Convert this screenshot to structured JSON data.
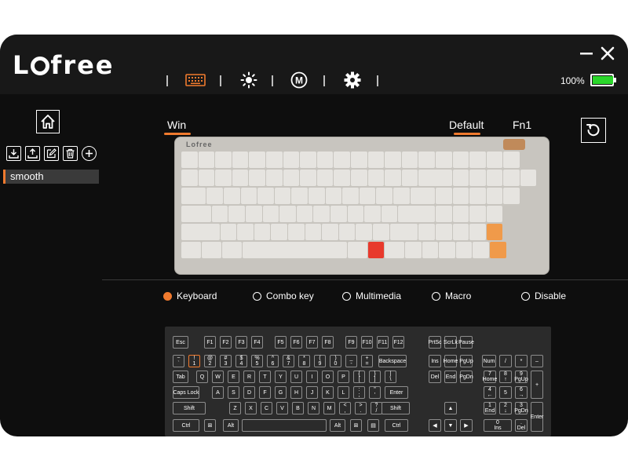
{
  "app": {
    "logo": "Lofree",
    "battery_percent": "100%",
    "battery_level": 1.0,
    "colors": {
      "accent": "#f07a2e",
      "battery": "#2bd62b",
      "background": "#0e0e0e"
    }
  },
  "nav": {
    "items": [
      {
        "icon": "keyboard-icon",
        "active": true
      },
      {
        "icon": "brightness-icon",
        "active": false
      },
      {
        "icon": "macro-m-icon",
        "active": false
      },
      {
        "icon": "gear-icon",
        "active": false
      }
    ]
  },
  "sidebar": {
    "tools": [
      "import-icon",
      "export-icon",
      "edit-icon",
      "delete-icon",
      "add-icon"
    ],
    "profiles": [
      "smooth"
    ]
  },
  "main": {
    "os_tab": "Win",
    "layer_tabs": [
      "Default",
      "Fn1"
    ],
    "keyboard_brand": "Lofree",
    "key_types": [
      "Keyboard",
      "Combo key",
      "Multimedia",
      "Macro",
      "Disable"
    ],
    "selected_key_type": "Keyboard"
  },
  "layout_keys": {
    "esc": "Esc",
    "f1": "F1",
    "f2": "F2",
    "f3": "F3",
    "f4": "F4",
    "f5": "F5",
    "f6": "F6",
    "f7": "F7",
    "f8": "F8",
    "f9": "F9",
    "f10": "F10",
    "f11": "F11",
    "f12": "F12",
    "prtsc": "PrtSc",
    "scrlk": "ScrLk",
    "pause": "Pause",
    "backtick": "~\n`",
    "n1": "!\n1",
    "n2": "@\n2",
    "n3": "#\n3",
    "n4": "$\n4",
    "n5": "%\n5",
    "n6": "^\n6",
    "n7": "&\n7",
    "n8": "*\n8",
    "n9": "(\n9",
    "n0": ")\n0",
    "minus": "_\n-",
    "equal": "+\n=",
    "backspace": "Backspace",
    "ins": "Ins",
    "home": "Home",
    "pgup": "PgUp",
    "num": "Num",
    "np_div": "/",
    "np_mul": "*",
    "np_minus": "–",
    "tab": "Tab",
    "q": "Q",
    "w": "W",
    "e": "E",
    "r": "R",
    "t": "T",
    "y": "Y",
    "u": "U",
    "i": "I",
    "o": "O",
    "p": "P",
    "lbracket": "{\n[",
    "rbracket": "}\n]",
    "backslash": "|\n\\",
    "del": "Del",
    "end": "End",
    "pgdn": "PgDn",
    "np7": "7\nHome",
    "np8": "8\n↑",
    "np9": "9\nPgUp",
    "np_plus": "+",
    "capslock": "Caps Lock",
    "a": "A",
    "s": "S",
    "d": "D",
    "f": "F",
    "g": "G",
    "h": "H",
    "j": "J",
    "k": "K",
    "l": "L",
    "semicolon": ":\n;",
    "quote": "\"\n'",
    "enter": "Enter",
    "np4": "4\n←",
    "np5": "5",
    "np6": "6\n→",
    "lshift": "Shift",
    "z": "Z",
    "x": "X",
    "c": "C",
    "v": "V",
    "b": "B",
    "n": "N",
    "m": "M",
    "comma": "<\n,",
    "period": ">\n.",
    "slash": "?\n/",
    "rshift": "Shift",
    "up": "▲",
    "np1": "1\nEnd",
    "np2": "2\n↓",
    "np3": "3\nPgDn",
    "np_enter": "Enter",
    "lctrl": "Ctrl",
    "lwin": "⊞",
    "lalt": "Alt",
    "space": "",
    "ralt": "Alt",
    "rwin": "⊞",
    "menu": "▤",
    "rctrl": "Ctrl",
    "left": "◀",
    "down": "▼",
    "right": "▶",
    "np0": "0\nIns",
    "np_dot": ".\nDel"
  }
}
